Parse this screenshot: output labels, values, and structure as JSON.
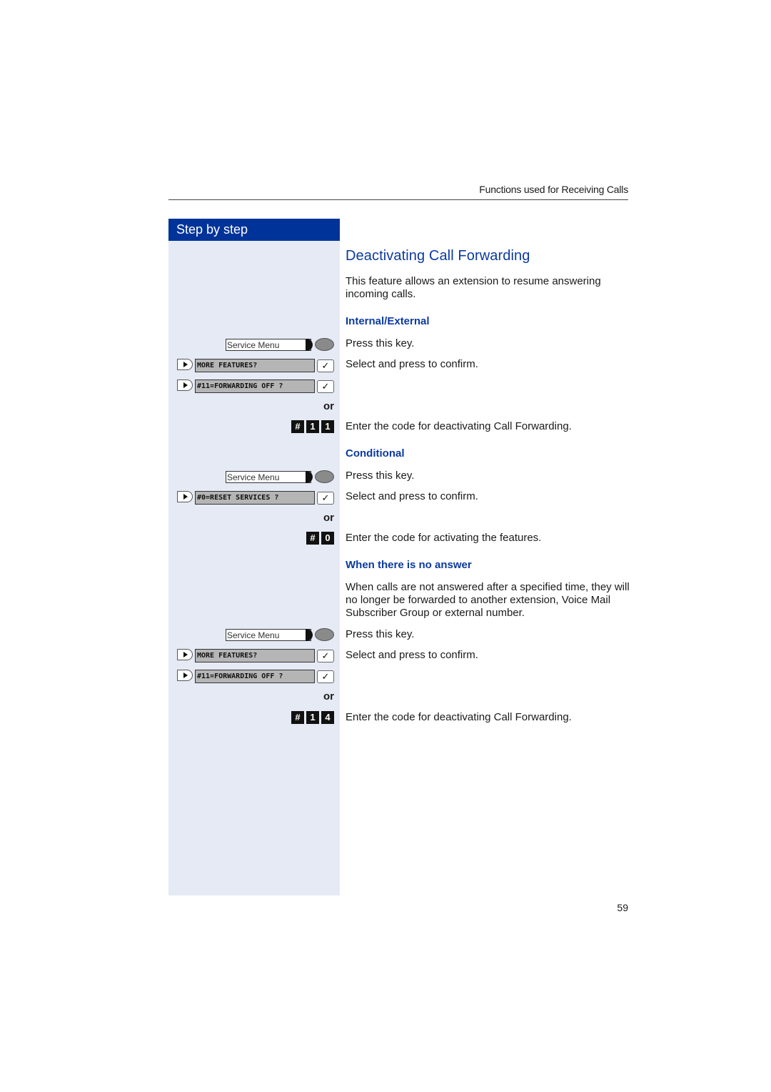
{
  "header": {
    "section": "Functions used for Receiving Calls"
  },
  "sidebar": {
    "title": "Step by step"
  },
  "main": {
    "title": "Deactivating Call Forwarding",
    "intro": "This feature allows an extension to resume answering incoming calls.",
    "sections": [
      {
        "heading": "Internal/External",
        "steps": [
          {
            "service_label": "Service Menu",
            "text": "Press this key."
          },
          {
            "displays": [
              "MORE FEATURES?",
              "#11=FORWARDING OFF ?"
            ],
            "text": "Select and press to confirm."
          },
          {
            "or": "or"
          },
          {
            "keys": [
              "#",
              "1",
              "1"
            ],
            "text": "Enter the code for deactivating Call Forwarding."
          }
        ]
      },
      {
        "heading": "Conditional",
        "steps": [
          {
            "service_label": "Service Menu",
            "text": "Press this key."
          },
          {
            "displays": [
              "#0=RESET SERVICES ?"
            ],
            "text": "Select and press to confirm."
          },
          {
            "or": "or"
          },
          {
            "keys": [
              "#",
              "0"
            ],
            "text": "Enter the code for activating the features."
          }
        ]
      },
      {
        "heading": "When there is no answer",
        "description": "When calls are not answered after a specified time, they will no longer be forwarded to another extension, Voice Mail Subscriber Group or external number.",
        "steps": [
          {
            "service_label": "Service Menu",
            "text": "Press this key."
          },
          {
            "displays": [
              "MORE FEATURES?",
              "#11=FORWARDING OFF ?"
            ],
            "text": "Select and press to confirm."
          },
          {
            "or": "or"
          },
          {
            "keys": [
              "#",
              "1",
              "4"
            ],
            "text": "Enter the code for deactivating Call Forwarding."
          }
        ]
      }
    ],
    "check_glyph": "✓"
  },
  "footer": {
    "page_number": "59"
  },
  "colors": {
    "brand_blue": "#003399",
    "heading_blue": "#0c3aa0",
    "sidebar_bg": "#e5eaf5"
  }
}
